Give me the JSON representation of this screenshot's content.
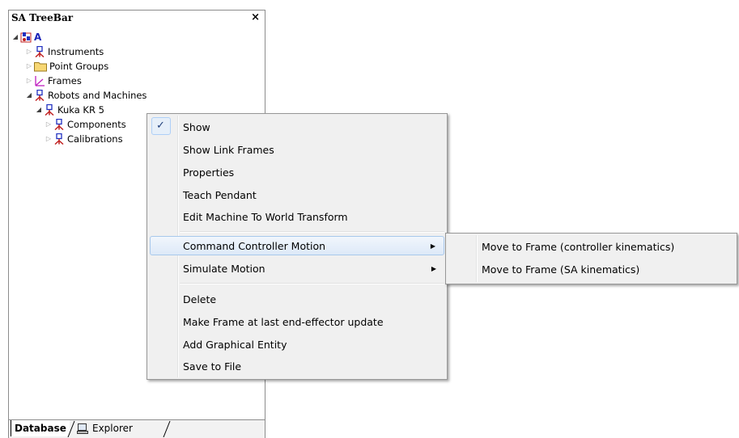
{
  "panel": {
    "title": "SA TreeBar",
    "close_glyph": "×"
  },
  "tree": {
    "root": {
      "label": "A",
      "icon": "instrument-group-icon",
      "color": "#1a24b8"
    },
    "items": [
      {
        "label": "Instruments",
        "icon": "instrument-icon"
      },
      {
        "label": "Point Groups",
        "icon": "folder-icon"
      },
      {
        "label": "Frames",
        "icon": "frame-axes-icon"
      },
      {
        "label": "Robots and Machines",
        "icon": "instrument-icon"
      },
      {
        "label": "Kuka KR 5",
        "icon": "instrument-icon"
      },
      {
        "label": "Components",
        "icon": "instrument-icon"
      },
      {
        "label": "Calibrations",
        "icon": "instrument-icon"
      }
    ]
  },
  "tabs": {
    "database": "Database",
    "explorer": "Explorer"
  },
  "context_menu": {
    "items": [
      {
        "label": "Show",
        "checked": true
      },
      {
        "label": "Show Link Frames"
      },
      {
        "label": "Properties"
      },
      {
        "label": "Teach Pendant"
      },
      {
        "label": "Edit Machine To World Transform"
      },
      {
        "label": "Command Controller Motion",
        "submenu": true,
        "highlighted": true
      },
      {
        "label": "Simulate Motion",
        "submenu": true
      },
      {
        "label": "Delete"
      },
      {
        "label": "Make Frame at last end-effector update"
      },
      {
        "label": "Add Graphical Entity"
      },
      {
        "label": "Save to File"
      }
    ]
  },
  "submenu": {
    "items": [
      {
        "label": "Move to Frame (controller kinematics)"
      },
      {
        "label": "Move to Frame (SA kinematics)"
      }
    ]
  },
  "colors": {
    "menu_bg": "#f0f0f0",
    "highlight_border": "#a8c8ec",
    "root_label": "#1a24b8",
    "folder_yellow": "#f7d774",
    "frame_magenta": "#c020c0"
  }
}
